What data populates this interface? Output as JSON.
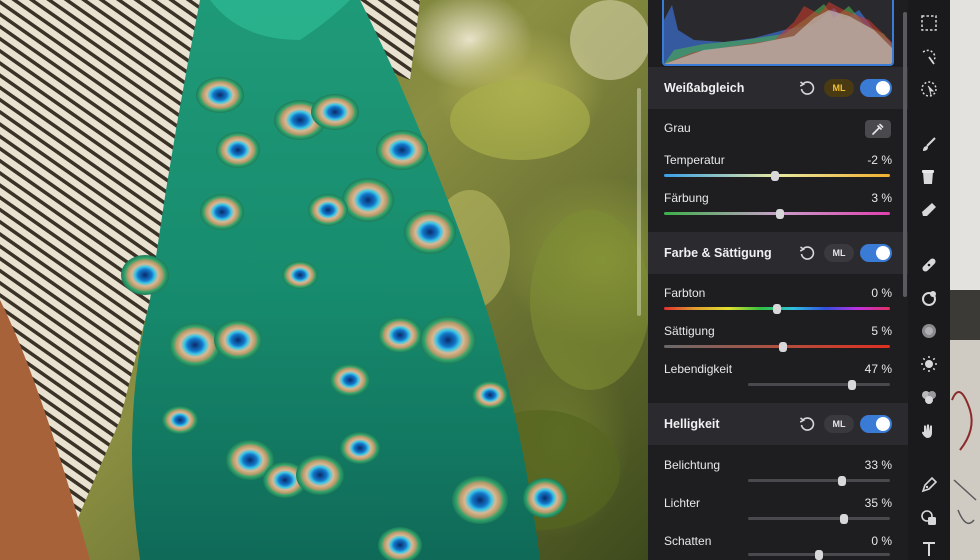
{
  "panel": {
    "white_balance": {
      "title": "Weißabgleich",
      "ml_label": "ML",
      "gray_label": "Grau",
      "temperature": {
        "label": "Temperatur",
        "value": "-2 %",
        "position": 0.49
      },
      "tint": {
        "label": "Färbung",
        "value": "3 %",
        "position": 0.515
      }
    },
    "color_saturation": {
      "title": "Farbe & Sättigung",
      "ml_label": "ML",
      "hue": {
        "label": "Farbton",
        "value": "0 %",
        "position": 0.5
      },
      "saturation": {
        "label": "Sättigung",
        "value": "5 %",
        "position": 0.525
      },
      "vibrance": {
        "label": "Lebendigkeit",
        "value": "47 %",
        "position": 0.735
      }
    },
    "brightness": {
      "title": "Helligkeit",
      "ml_label": "ML",
      "exposure": {
        "label": "Belichtung",
        "value": "33 %",
        "position": 0.665
      },
      "highlights": {
        "label": "Lichter",
        "value": "35 %",
        "position": 0.675
      },
      "shadows": {
        "label": "Schatten",
        "value": "0 %",
        "position": 0.5
      }
    }
  },
  "colors": {
    "accent": "#3a7bd5",
    "ml_active": "#f0c030",
    "panel_bg": "#1e1d20",
    "section_bg": "#2b2a2e"
  },
  "tools": [
    "marquee-select-icon",
    "magic-select-icon",
    "auto-select-icon",
    "paintbrush-icon",
    "paint-bucket-icon",
    "eraser-icon",
    "healing-bandage-icon",
    "clone-stamp-icon",
    "blur-icon",
    "light-adjust-icon",
    "color-cells-icon",
    "smudge-hand-icon",
    "pen-icon",
    "shapes-icon",
    "text-icon"
  ]
}
